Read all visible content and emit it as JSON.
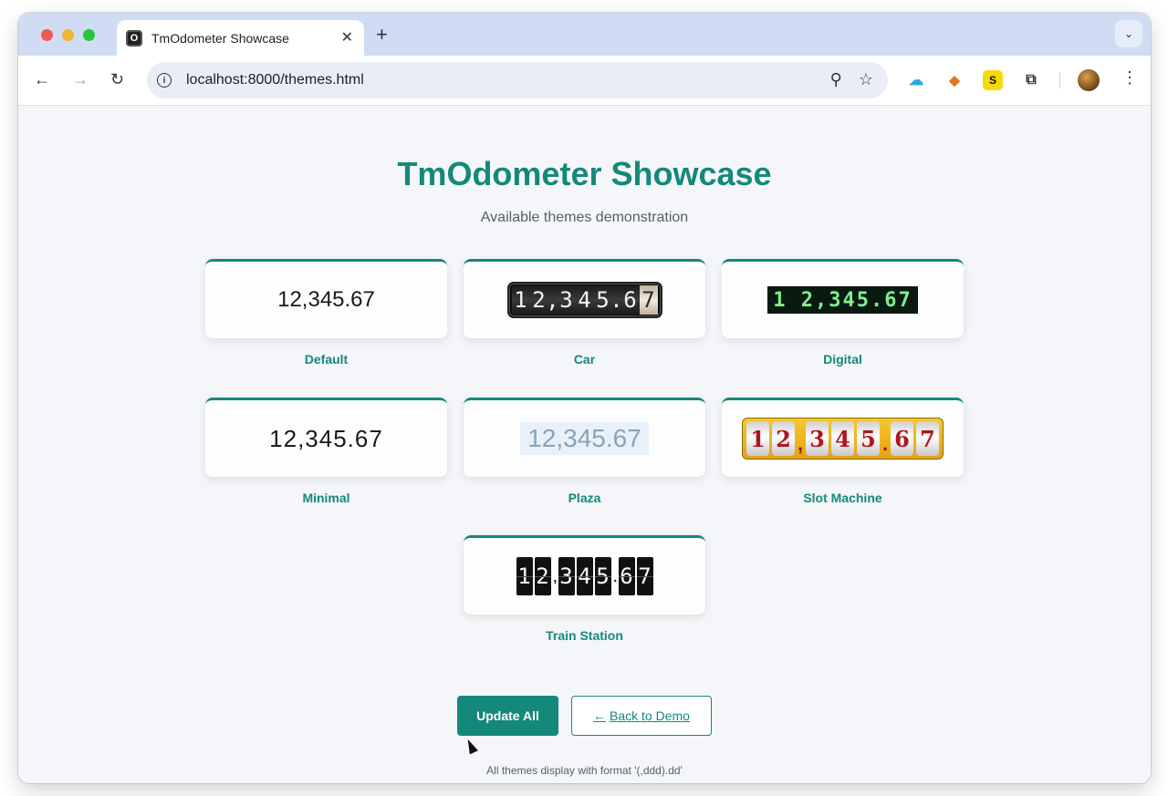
{
  "browser": {
    "tab_title": "TmOdometer Showcase",
    "favicon_letter": "O",
    "url": "localhost:8000/themes.html"
  },
  "page": {
    "title": "TmOdometer Showcase",
    "subtitle": "Available themes demonstration",
    "accent_color": "#14897a"
  },
  "themes": [
    {
      "label": "Default",
      "value": "12,345.67"
    },
    {
      "label": "Car",
      "value": "12,345.67"
    },
    {
      "label": "Digital",
      "value": "1 2,345.67"
    },
    {
      "label": "Minimal",
      "value": "12,345.67"
    },
    {
      "label": "Plaza",
      "value": "12,345.67"
    },
    {
      "label": "Slot Machine",
      "value": "12,345.67"
    },
    {
      "label": "Train Station",
      "value": "12,345.67"
    }
  ],
  "digits": {
    "d1": "1",
    "d2": "2",
    "sep_comma": ",",
    "d3": "3",
    "d4": "4",
    "d5": "5",
    "sep_dot": ".",
    "d6": "6",
    "d7": "7"
  },
  "actions": {
    "update_label": "Update All",
    "back_label": "Back to Demo",
    "back_arrow": "←"
  },
  "footnote": "All themes display with format '(,ddd).dd'"
}
